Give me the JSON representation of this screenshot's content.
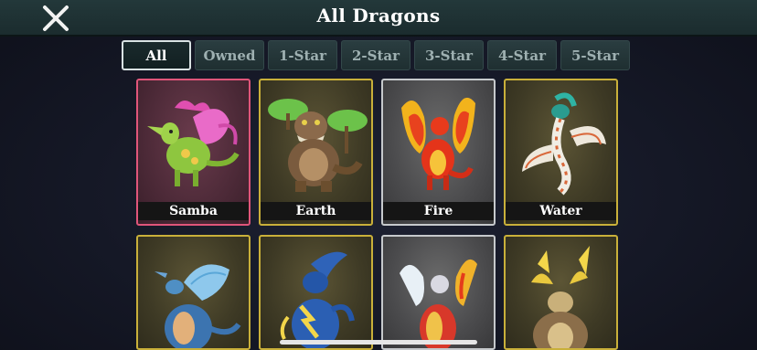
{
  "header": {
    "title": "All Dragons",
    "close_icon": "close-x-icon"
  },
  "tabs": [
    {
      "label": "All",
      "active": true
    },
    {
      "label": "Owned",
      "active": false
    },
    {
      "label": "1-Star",
      "active": false
    },
    {
      "label": "2-Star",
      "active": false
    },
    {
      "label": "3-Star",
      "active": false
    },
    {
      "label": "4-Star",
      "active": false
    },
    {
      "label": "5-Star",
      "active": false
    }
  ],
  "dragons": [
    {
      "name": "Samba",
      "frame": "pink"
    },
    {
      "name": "Earth",
      "frame": "gold"
    },
    {
      "name": "Fire",
      "frame": "silver"
    },
    {
      "name": "Water",
      "frame": "gold"
    },
    {
      "name": "",
      "frame": "gold"
    },
    {
      "name": "",
      "frame": "gold"
    },
    {
      "name": "",
      "frame": "silver"
    },
    {
      "name": "",
      "frame": "gold"
    }
  ]
}
